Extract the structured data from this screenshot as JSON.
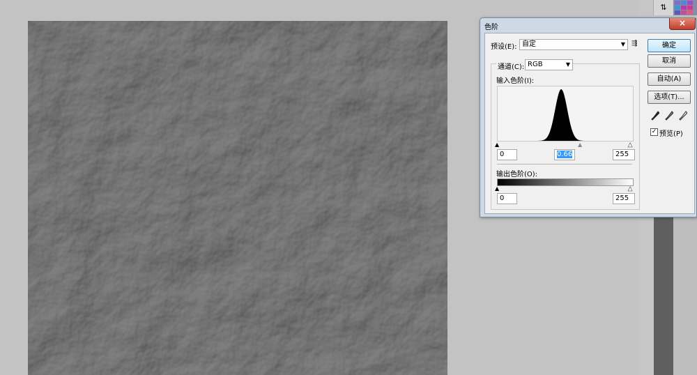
{
  "dialog": {
    "title": "色阶",
    "close_label": "×",
    "preset_label": "预设(E):",
    "preset_value": "自定",
    "channel_label": "通道(C):",
    "channel_value": "RGB",
    "input_levels_label": "输入色阶(I):",
    "input_black": "0",
    "input_gamma": "0.66",
    "input_white": "255",
    "output_levels_label": "输出色阶(O):",
    "output_black": "0",
    "output_white": "255",
    "buttons": {
      "ok": "确定",
      "cancel": "取消",
      "auto": "自动(A)",
      "options": "选项(T)..."
    },
    "preview_label": "预览(P)",
    "preview_checked": true,
    "histogram": {
      "peak_position": 0.47,
      "peak_width": 0.045,
      "color": "#000000"
    }
  },
  "colors": {
    "canvas_base": "#5a5a5a",
    "background": "#c3c3c3",
    "dialog_frame": "#cdd9e6",
    "close_button": "#c2402a",
    "ok_button_border": "#3c7fb1",
    "selection": "#3399ff"
  },
  "icons": {
    "preset_menu": "preset-menu-icon",
    "black_eyedropper": "black-point-eyedropper-icon",
    "gray_eyedropper": "gray-point-eyedropper-icon",
    "white_eyedropper": "white-point-eyedropper-icon",
    "panel_toggle": "panel-toggle-icon"
  }
}
